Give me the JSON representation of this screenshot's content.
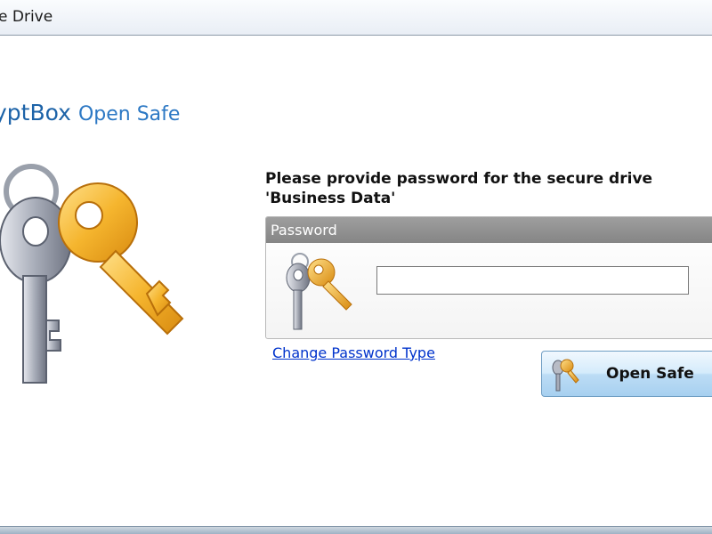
{
  "window": {
    "title": "e Drive"
  },
  "brand": {
    "app_name": "yptBox",
    "subtitle": "Open Safe"
  },
  "prompt": {
    "line1": "Please provide password for the secure drive",
    "line2": "'Business Data'"
  },
  "password_panel": {
    "header": "Password",
    "input_value": "",
    "input_placeholder": ""
  },
  "links": {
    "change_password_type": "Change Password Type"
  },
  "buttons": {
    "open_safe": "Open Safe"
  },
  "icons": {
    "large": "keys-icon",
    "small": "keys-icon",
    "button": "key-icon"
  },
  "colors": {
    "brand_blue": "#1d63a8",
    "link_blue": "#0033cc",
    "header_gray": "#8f8f8f",
    "key_gold": "#f2b632",
    "key_silver": "#a9adb8"
  }
}
